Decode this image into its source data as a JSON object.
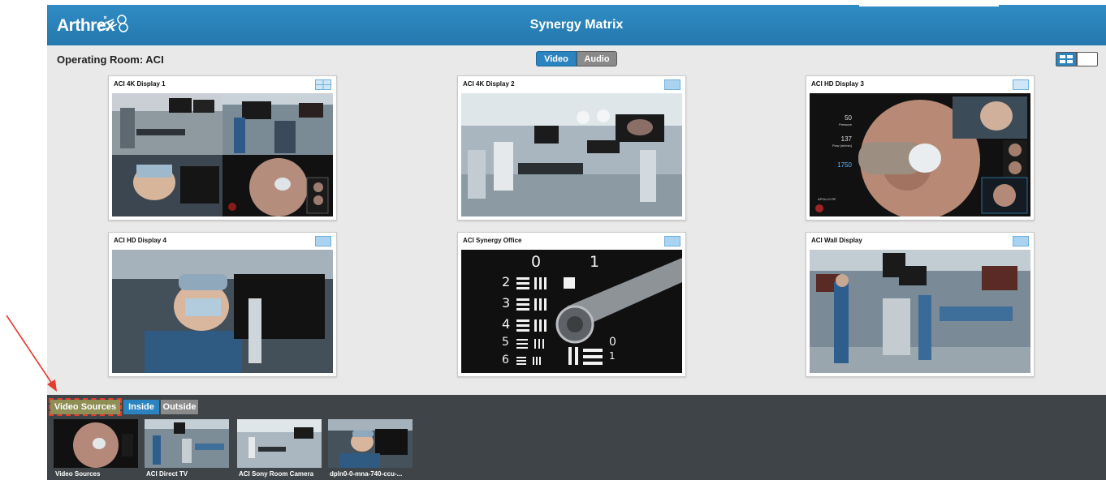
{
  "header": {
    "logo": "Arthrex",
    "title": "Synergy Matrix"
  },
  "room": {
    "label": "Operating Room: ACI"
  },
  "mode_toggle": {
    "video": "Video",
    "audio": "Audio"
  },
  "displays": [
    {
      "name": "ACI 4K Display 1"
    },
    {
      "name": "ACI 4K Display 2"
    },
    {
      "name": "ACI HD Display 3"
    },
    {
      "name": "ACI HD Display 4"
    },
    {
      "name": "ACI Synergy Office"
    },
    {
      "name": "ACI Wall Display"
    }
  ],
  "display3_overlay": {
    "pressure": "50",
    "pressure_unit": "Pressure",
    "flow": "137",
    "flow_unit": "Flow (ml/min)",
    "speed": "1750",
    "brand": "APOLLO RF"
  },
  "office_chart": {
    "top_digits": [
      "0",
      "1"
    ],
    "side_digits": [
      "2",
      "3",
      "4",
      "5",
      "6"
    ],
    "small_digits": [
      "0",
      "1"
    ]
  },
  "sources": {
    "tabs": {
      "video_sources": "Video Sources",
      "inside": "Inside",
      "outside": "Outside"
    },
    "items": [
      {
        "label": "Video Sources"
      },
      {
        "label": "ACI Direct TV"
      },
      {
        "label": "ACI Sony Room Camera"
      },
      {
        "label": "dpln0-0-mna-740-ccu-..."
      }
    ]
  },
  "colors": {
    "header": "#2f8cc4",
    "active": "#2b83bf",
    "annotation": "#e53a2e",
    "bottom_bar": "#3e4448"
  }
}
